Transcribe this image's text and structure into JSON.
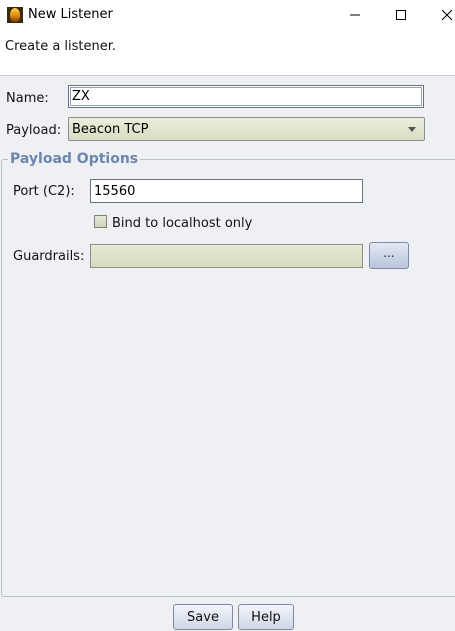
{
  "window": {
    "title": "New Listener"
  },
  "banner": {
    "text": "Create a listener."
  },
  "form": {
    "name_label": "Name:",
    "name_value": "ZX",
    "payload_label": "Payload:",
    "payload_value": "Beacon TCP"
  },
  "payload_options": {
    "title": "Payload Options",
    "port_label": "Port (C2):",
    "port_value": "15560",
    "bind_label": "Bind to localhost only",
    "bind_checked": false,
    "guardrails_label": "Guardrails:",
    "guardrails_value": "",
    "guardrails_button": "..."
  },
  "buttons": {
    "save": "Save",
    "help": "Help"
  },
  "icons": {
    "app": "cobalt-strike-app-icon",
    "minimize": "minimize-icon",
    "maximize": "maximize-icon",
    "close": "close-icon",
    "dropdown": "chevron-down-icon"
  }
}
